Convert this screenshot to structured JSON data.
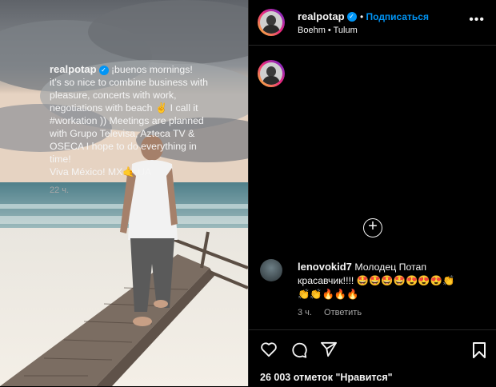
{
  "post": {
    "username": "realpotap",
    "follow_label": "Подписаться",
    "location": "Boehm • Tulum",
    "more_label": "•••",
    "caption_lines": [
      "¡buenos mornings!",
      "it’s so nice to combine business with",
      "pleasure, concerts with work,",
      "negotiations with beach ✌️ I call it",
      "#workation )) Meetings are planned",
      "with Grupo Televisa, Azteca TV &",
      "OSECA I hope to do everything in",
      "time!",
      "Viva México! MX🤙 UA"
    ],
    "caption_time": "22 ч.",
    "load_more_icon": "plus-circle-icon"
  },
  "comment": {
    "username": "lenovokid7",
    "text_line1": "Молодец Потап",
    "text_line2": "красавчик!!!! 🤩🤩🤩🤩😍😍😍👏",
    "text_line3": "👏👏🔥🔥🔥",
    "time": "3 ч.",
    "reply_label": "Ответить"
  },
  "actions": {
    "like_icon": "heart-icon",
    "comment_icon": "comment-icon",
    "share_icon": "send-icon",
    "save_icon": "bookmark-icon"
  },
  "likes_text": "26 003 отметок \"Нравится\"",
  "colors": {
    "accent": "#0095f6",
    "background": "#000000",
    "muted": "#a8a8a8"
  }
}
